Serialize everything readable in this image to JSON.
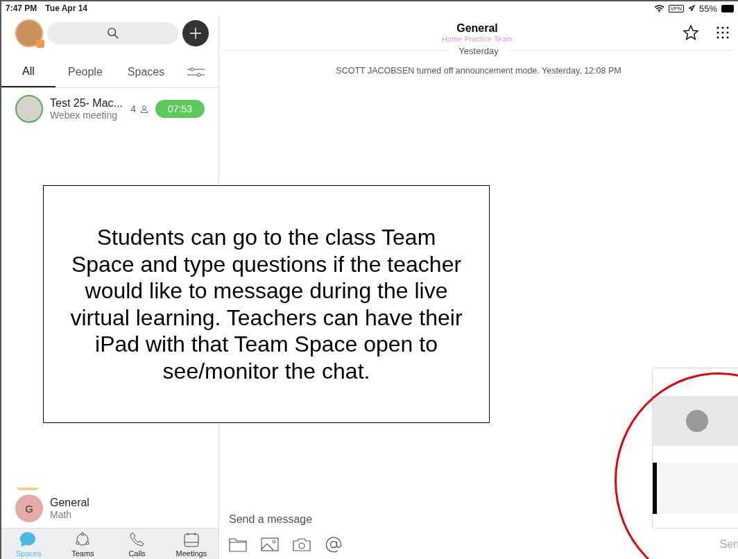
{
  "status_bar": {
    "time": "7:47 PM",
    "date": "Tue Apr 14",
    "vpn": "VPN",
    "battery": "55%"
  },
  "sidebar": {
    "tabs": [
      {
        "label": "All",
        "selected": true
      },
      {
        "label": "People",
        "selected": false
      },
      {
        "label": "Spaces",
        "selected": false
      }
    ],
    "conversations": [
      {
        "kind": "meeting",
        "title": "Test 25- Mac...",
        "subtitle": "Webex meeting",
        "participants": "4",
        "badge": "07:53"
      }
    ],
    "pinned": [
      {
        "kind": "space",
        "initial": "G",
        "title": "General",
        "subtitle": "Math"
      }
    ]
  },
  "bottom_nav": [
    {
      "label": "Spaces",
      "selected": true
    },
    {
      "label": "Teams",
      "selected": false
    },
    {
      "label": "Calls",
      "selected": false
    },
    {
      "label": "Meetings",
      "selected": false
    }
  ],
  "chat": {
    "title": "General",
    "subtitle": "Home Practice Team",
    "date_divider": "Yesterday",
    "messages": [
      "SCOTT JACOBSEN turned off announcement mode. Yesterday, 12:08 PM"
    ],
    "composer": {
      "placeholder": "Send a message",
      "send": "Sen"
    }
  },
  "annotation": {
    "text": "Students can go to the class Team Space and type questions if the teacher would like to message during the live virtual learning. Teachers can have their iPad with that Team Space open to see/monitor the chat."
  }
}
